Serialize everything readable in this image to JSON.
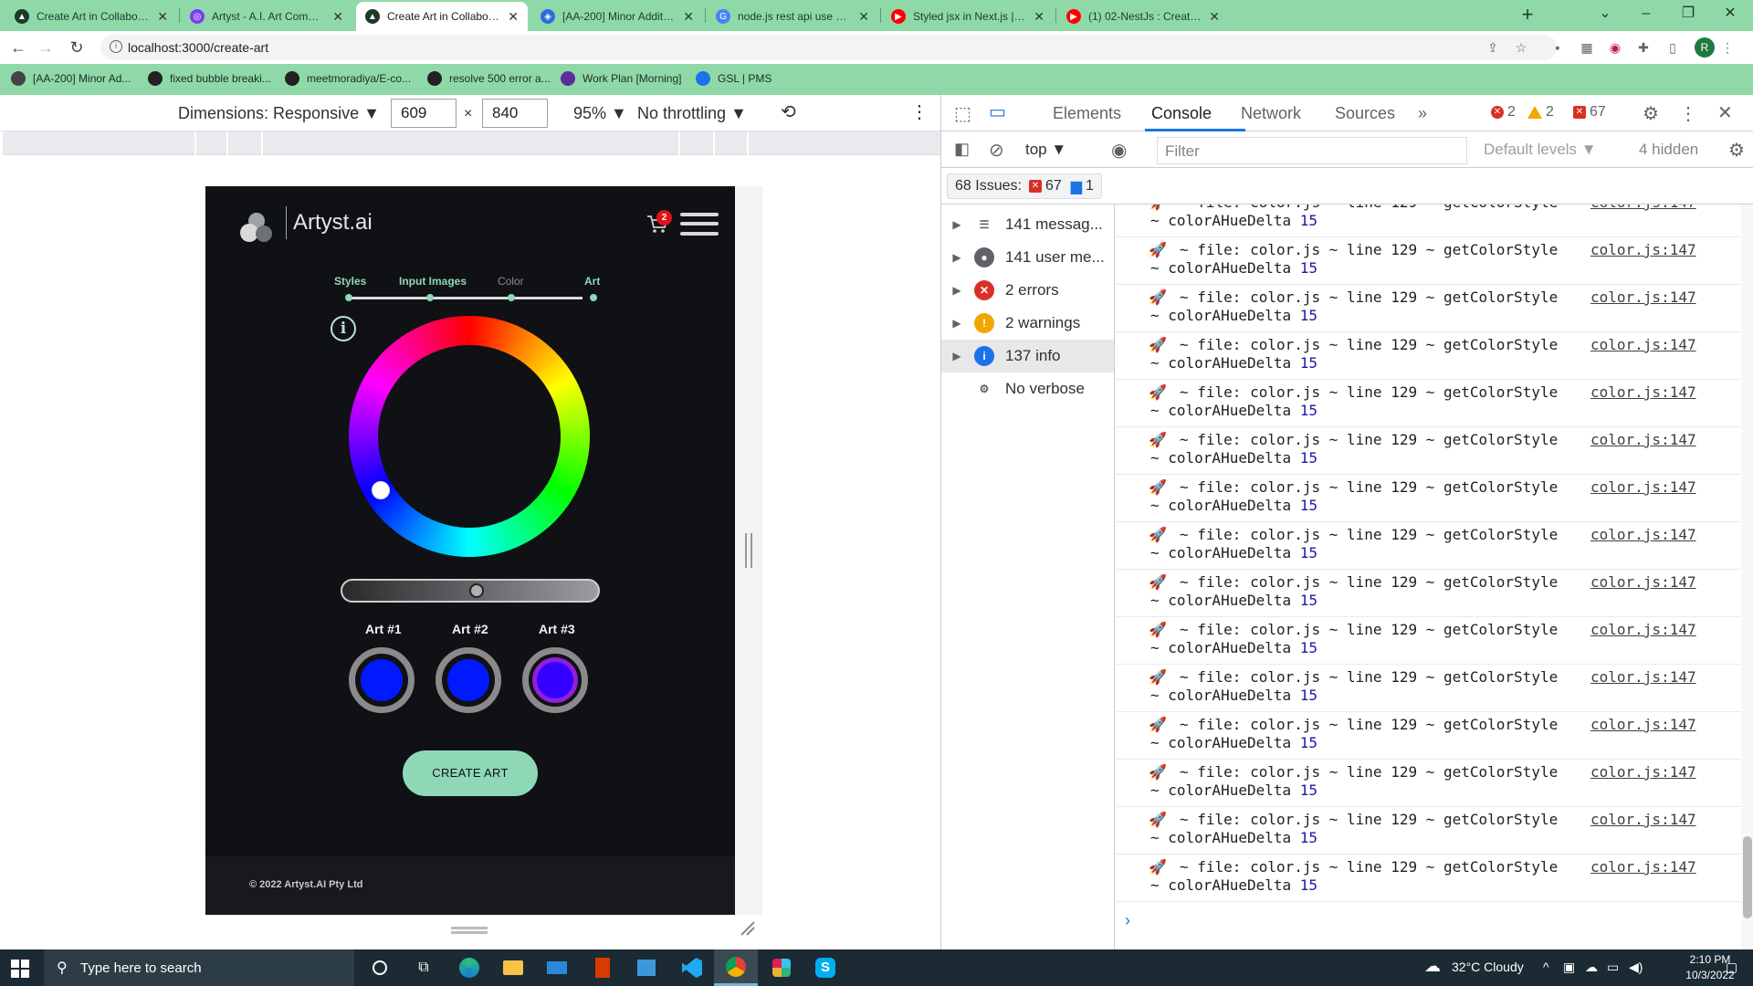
{
  "browser": {
    "tabs": [
      {
        "title": "Create Art in Collaboration with",
        "active": false
      },
      {
        "title": "Artyst - A.I. Art Commissions - A",
        "active": false
      },
      {
        "title": "Create Art in Collaboration with",
        "active": true
      },
      {
        "title": "[AA-200] Minor Additions and F",
        "active": false
      },
      {
        "title": "node.js rest api use callback fun",
        "active": false
      },
      {
        "title": "Styled jsx in Next.js | NextJs Tut",
        "active": false
      },
      {
        "title": "(1) 02-NestJs : Create App By us",
        "active": false
      }
    ],
    "url": "localhost:3000/create-art",
    "profile_initial": "R",
    "bookmarks": [
      "[AA-200] Minor Ad...",
      "fixed bubble breaki...",
      "meetmoradiya/E-co...",
      "resolve 500 error a...",
      "Work Plan [Morning]",
      "GSL | PMS"
    ]
  },
  "device_toolbar": {
    "dimensions_label": "Dimensions: Responsive",
    "width": "609",
    "times": "×",
    "height": "840",
    "zoom": "95%",
    "throttling": "No throttling"
  },
  "app": {
    "brand": "Artyst.ai",
    "cart_count": "2",
    "steps": [
      "Styles",
      "Input Images",
      "Color",
      "Art"
    ],
    "info_symbol": "i",
    "hue_ring_colors": [
      "#ff0000",
      "#ffff00",
      "#00ff00",
      "#00ffff",
      "#0000ff",
      "#ff00ff"
    ],
    "art_items": [
      {
        "label": "Art #1",
        "color": "#0019ff"
      },
      {
        "label": "Art #2",
        "color": "#0019ff"
      },
      {
        "label": "Art #3",
        "color": "#3300ff",
        "ring": "#8f1fd9"
      }
    ],
    "create_button": "CREATE ART",
    "footer": "© 2022 Artyst.AI Pty Ltd",
    "accent": "#8ed8b8"
  },
  "devtools": {
    "tabs": [
      "Elements",
      "Console",
      "Network",
      "Sources"
    ],
    "active_tab": "Console",
    "more_tabs": "»",
    "errors": "2",
    "warnings": "2",
    "issues_count": "67",
    "context": "top",
    "filter_placeholder": "Filter",
    "levels": "Default levels",
    "hidden": "4 hidden",
    "issues_label": "68 Issues:",
    "issues_errors": "67",
    "issues_info": "1",
    "sidebar": [
      {
        "label": "141 messag...",
        "icon": "list"
      },
      {
        "label": "141 user me...",
        "icon": "user"
      },
      {
        "label": "2 errors",
        "icon": "error"
      },
      {
        "label": "2 warnings",
        "icon": "warning"
      },
      {
        "label": "137 info",
        "icon": "info"
      },
      {
        "label": "No verbose",
        "icon": "gear"
      }
    ],
    "log_line1": "~ file: color.js ~ line 129 ~ getColorStyle",
    "log_line2": "~ colorAHueDelta",
    "log_value": "15",
    "log_source": "color.js:147",
    "log_count": 15,
    "prompt": "›"
  },
  "taskbar": {
    "search_placeholder": "Type here to search",
    "weather": "32°C  Cloudy",
    "time": "2:10 PM",
    "date": "10/3/2022"
  }
}
